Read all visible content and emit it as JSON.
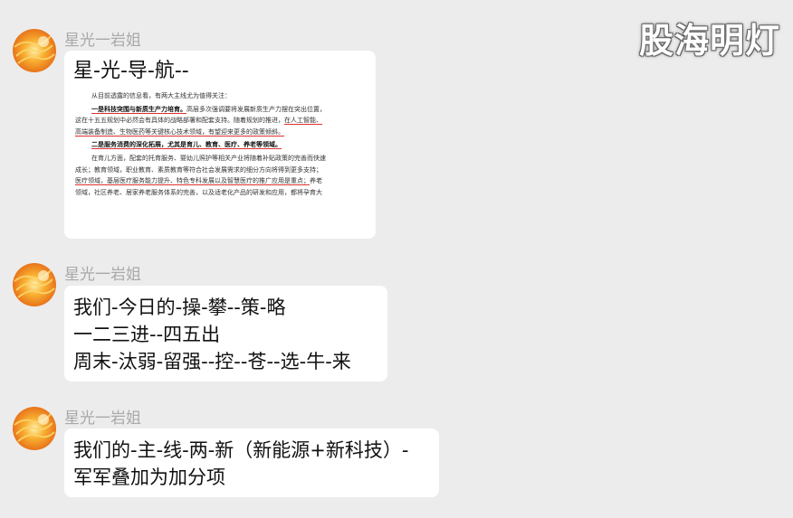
{
  "watermark": "股海明灯",
  "colors": {
    "background": "#ececec",
    "bubble": "#ffffff",
    "sender_name": "#a9a9a9",
    "underline_red": "#e03030"
  },
  "messages": [
    {
      "sender": "星光一岩姐",
      "avatar_icon": "orange-flower-avatar-icon",
      "title": "星-光-导-航--",
      "image_lines": [
        "从目前透露的信息看，有两大主线尤为值得关注：",
        "一是科技突围与新质生产力培育。",
        "高层多次强调要将发展新质生产力摆在突出位置，",
        "这在十五五规划中必然会有具体的战略部署和配套支持。随着规划的推进，",
        "在人工智能、",
        "高端装备制造、生物医药等关键核心技术领域，",
        "有望迎来更多的政策倾斜。",
        "二是服务消费的深化拓展，尤其是育儿、教育、医疗、养老等领域。",
        "在育儿方面，配套的托育服务、婴幼儿照护等相关产业将随着补贴政策的完善而快速",
        "成长；教育领域，职业教育、素质教育等符合社会发展需求的细分方向将得到更多支持；",
        "医疗领域，基层医疗服务能力提升、特色专科发展以及智慧医疗的推广应用是重点；",
        "养老",
        "领域，社区养老、居家养老服务体系的完善，以及适老化产品的研发和应用，都将孕育大"
      ]
    },
    {
      "sender": "星光一岩姐",
      "avatar_icon": "orange-flower-avatar-icon",
      "text": "我们-今日的-操-攀--策-略\n一二三进--四五出\n周末-汰弱-留强--控--苍--选-牛-来"
    },
    {
      "sender": "星光一岩姐",
      "avatar_icon": "orange-flower-avatar-icon",
      "text": "我们的-主-线-两-新（新能源+新科技）-\n军军叠加为加分项"
    }
  ]
}
